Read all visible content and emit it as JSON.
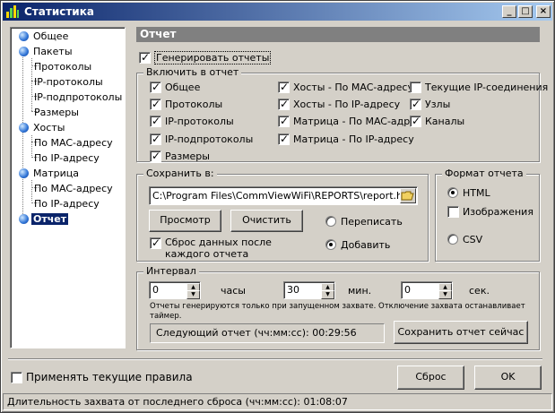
{
  "window": {
    "title": "Статистика"
  },
  "tree": {
    "items": [
      {
        "label": "Общее",
        "level": 0
      },
      {
        "label": "Пакеты",
        "level": 0
      },
      {
        "label": "Протоколы",
        "level": 1
      },
      {
        "label": "IP-протоколы",
        "level": 1
      },
      {
        "label": "IP-подпротоколы",
        "level": 1
      },
      {
        "label": "Размеры",
        "level": 1
      },
      {
        "label": "Хосты",
        "level": 0
      },
      {
        "label": "По MAC-адресу",
        "level": 1
      },
      {
        "label": "По IP-адресу",
        "level": 1
      },
      {
        "label": "Матрица",
        "level": 0
      },
      {
        "label": "По MAC-адресу",
        "level": 1
      },
      {
        "label": "По IP-адресу",
        "level": 1
      },
      {
        "label": "Отчет",
        "level": 0,
        "selected": true
      }
    ]
  },
  "panel": {
    "header": "Отчет",
    "generate": {
      "label": "Генерировать отчеты",
      "checked": true
    },
    "include": {
      "title": "Включить в отчет",
      "col1": [
        {
          "label": "Общее",
          "checked": true
        },
        {
          "label": "Протоколы",
          "checked": true
        },
        {
          "label": "IP-протоколы",
          "checked": true
        },
        {
          "label": "IP-подпротоколы",
          "checked": true
        },
        {
          "label": "Размеры",
          "checked": true
        }
      ],
      "col2": [
        {
          "label": "Хосты - По MAC-адресу",
          "checked": true
        },
        {
          "label": "Хосты - По IP-адресу",
          "checked": true
        },
        {
          "label": "Матрица - По MAC-адре",
          "checked": true
        },
        {
          "label": "Матрица - По IP-адресу",
          "checked": true
        }
      ],
      "col3": [
        {
          "label": "Текущие IP-соединения",
          "checked": false
        },
        {
          "label": "Узлы",
          "checked": true
        },
        {
          "label": "Каналы",
          "checked": true
        }
      ]
    },
    "save": {
      "title": "Сохранить в:",
      "path": "C:\\Program Files\\CommViewWiFi\\REPORTS\\report.htm",
      "view_button": "Просмотр",
      "clear_button": "Очистить",
      "overwrite": "Переписать",
      "append": "Добавить",
      "reset": {
        "label_line1": "Сброс данных после",
        "label_line2": "каждого отчета",
        "checked": true
      }
    },
    "format": {
      "title": "Формат отчета",
      "html": "HTML",
      "images": "Изображения",
      "csv": "CSV",
      "selected": "html"
    },
    "interval": {
      "title": "Интервал",
      "hours_value": "0",
      "hours_label": "часы",
      "minutes_value": "30",
      "minutes_label": "мин.",
      "seconds_value": "0",
      "seconds_label": "сек.",
      "note_line1": "Отчеты генерируются только при запущенном захвате. Отключение захвата останавливает",
      "note_line2": "таймер.",
      "next_report": "Следующий отчет (чч:мм:сс): 00:29:56",
      "save_now_button": "Сохранить отчет сейчас"
    }
  },
  "footer": {
    "apply_rules": {
      "label": "Применять текущие правила",
      "checked": false
    },
    "reset_button": "Сброс",
    "ok_button": "OK"
  },
  "statusbar": {
    "text": "Длительность захвата от последнего сброса (чч:мм:сс): 01:08:07"
  }
}
